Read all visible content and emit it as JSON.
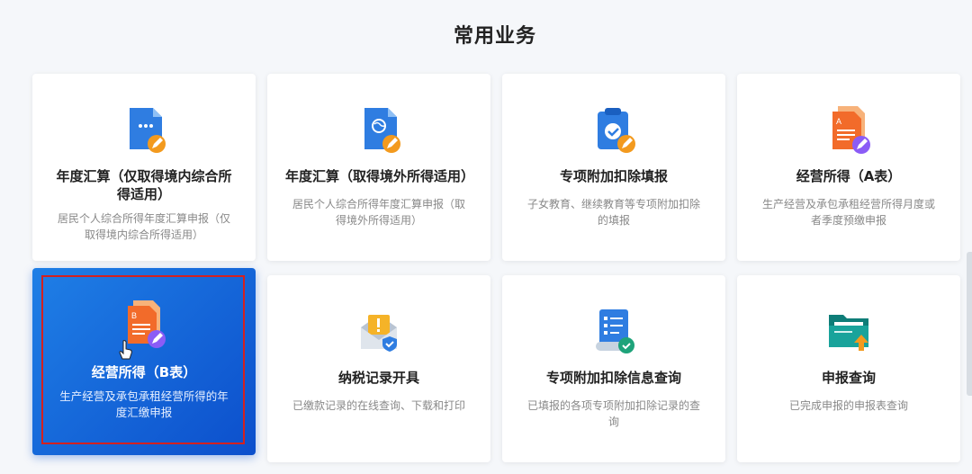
{
  "page": {
    "title": "常用业务"
  },
  "cards": [
    {
      "title": "年度汇算（仅取得境内综合所得适用）",
      "desc": "居民个人综合所得年度汇算申报（仅取得境内综合所得适用）",
      "icon": "annual-settlement-domestic-icon"
    },
    {
      "title": "年度汇算（取得境外所得适用）",
      "desc": "居民个人综合所得年度汇算申报（取得境外所得适用）",
      "icon": "annual-settlement-overseas-icon"
    },
    {
      "title": "专项附加扣除填报",
      "desc": "子女教育、继续教育等专项附加扣除的填报",
      "icon": "clipboard-check-icon"
    },
    {
      "title": "经营所得（A表）",
      "desc": "生产经营及承包承租经营所得月度或者季度预缴申报",
      "icon": "document-a-icon"
    },
    {
      "title": "经营所得（B表）",
      "desc": "生产经营及承包承租经营所得的年度汇缴申报",
      "icon": "document-b-icon",
      "selected": true
    },
    {
      "title": "纳税记录开具",
      "desc": "已缴款记录的在线查询、下载和打印",
      "icon": "tax-record-envelope-icon"
    },
    {
      "title": "专项附加扣除信息查询",
      "desc": "已填报的各项专项附加扣除记录的查询",
      "icon": "checklist-scroll-icon"
    },
    {
      "title": "申报查询",
      "desc": "已完成申报的申报表查询",
      "icon": "folder-upload-icon"
    }
  ],
  "colors": {
    "accent": "#1f7fe6",
    "accent_dark": "#0c4fcc",
    "selection_border": "#d4211f",
    "orange": "#f39a1e",
    "purple": "#8b5cf6"
  }
}
